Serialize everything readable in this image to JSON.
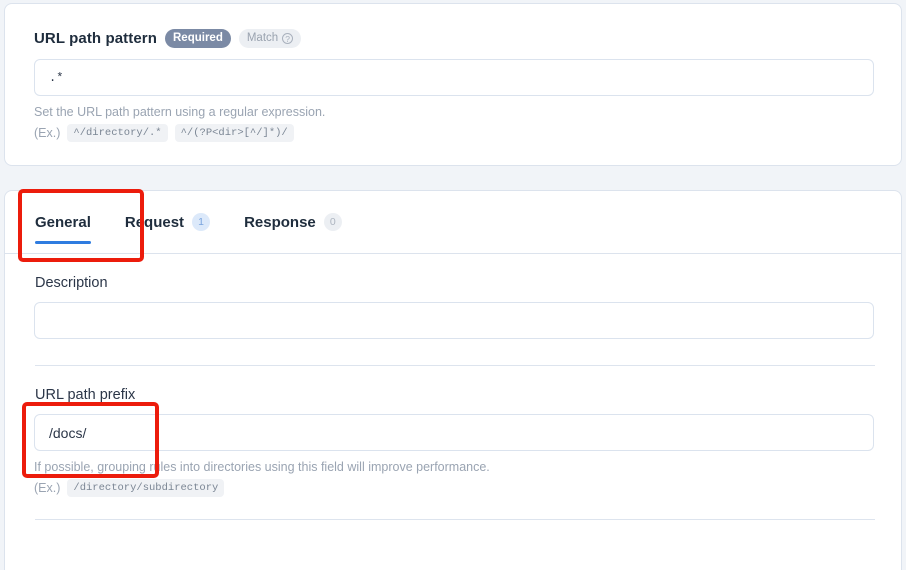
{
  "colors": {
    "page_background": "#f1f4f8",
    "card_background": "#ffffff",
    "card_border": "#dce3ed",
    "accent_tab_underline": "#2f7ce0",
    "badge_required": "#7b8aa5",
    "badge_count_blue": "#dce9fa",
    "badge_count_gray": "#eceff3",
    "annotation_red": "#ec1c0c",
    "help_text": "#9aa4b2",
    "label_text": "#1f2d3d"
  },
  "pattern_card": {
    "label": "URL path pattern",
    "required_badge": "Required",
    "match_badge": "Match",
    "match_help_icon": "question-circle-icon",
    "input_value": ".*",
    "input_placeholder": "",
    "help_text": "Set the URL path pattern using a regular expression.",
    "example_prefix": "(Ex.)",
    "examples": [
      "^/directory/.*",
      "^/(?P<dir>[^/]*)/"
    ]
  },
  "tabs": [
    {
      "label": "General",
      "badge": "",
      "badge_style": "none",
      "active": true
    },
    {
      "label": "Request",
      "badge": "1",
      "badge_style": "blue",
      "active": false
    },
    {
      "label": "Response",
      "badge": "0",
      "badge_style": "gray",
      "active": false
    }
  ],
  "general_tab": {
    "description": {
      "label": "Description",
      "input_value": "",
      "input_placeholder": ""
    },
    "url_path_prefix": {
      "label": "URL path prefix",
      "input_value": "/docs/",
      "input_placeholder": "",
      "help_text": "If possible, grouping rules into directories using this field will improve performance.",
      "example_prefix": "(Ex.)",
      "examples": [
        "/directory/subdirectory"
      ]
    }
  },
  "annotations": [
    {
      "name": "highlight-general-tab",
      "target": "General tab"
    },
    {
      "name": "highlight-url-path-prefix",
      "target": "URL path prefix field"
    }
  ]
}
